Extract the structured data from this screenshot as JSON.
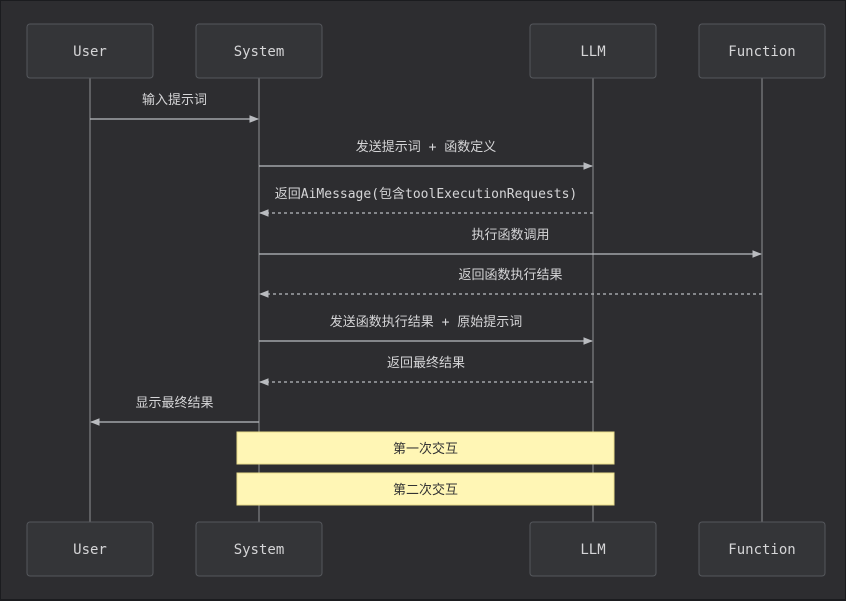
{
  "actors": [
    {
      "id": "user",
      "label": "User"
    },
    {
      "id": "system",
      "label": "System"
    },
    {
      "id": "llm",
      "label": "LLM"
    },
    {
      "id": "function",
      "label": "Function"
    }
  ],
  "messages": [
    {
      "from": "user",
      "to": "system",
      "label": "输入提示词",
      "style": "solid"
    },
    {
      "from": "system",
      "to": "llm",
      "label": "发送提示词 + 函数定义",
      "style": "solid"
    },
    {
      "from": "llm",
      "to": "system",
      "label": "返回AiMessage(包含toolExecutionRequests)",
      "style": "dashed"
    },
    {
      "from": "system",
      "to": "function",
      "label": "执行函数调用",
      "style": "solid"
    },
    {
      "from": "function",
      "to": "system",
      "label": "返回函数执行结果",
      "style": "dashed"
    },
    {
      "from": "system",
      "to": "llm",
      "label": "发送函数执行结果 + 原始提示词",
      "style": "solid"
    },
    {
      "from": "llm",
      "to": "system",
      "label": "返回最终结果",
      "style": "dashed"
    },
    {
      "from": "system",
      "to": "user",
      "label": "显示最终结果",
      "style": "solid"
    }
  ],
  "notes": [
    {
      "label": "第一次交互"
    },
    {
      "label": "第二次交互"
    }
  ],
  "colors": {
    "background": "#2d2d30",
    "actor_fill": "#343538",
    "line": "#b9bbbf",
    "note_fill": "#fff6b5"
  }
}
